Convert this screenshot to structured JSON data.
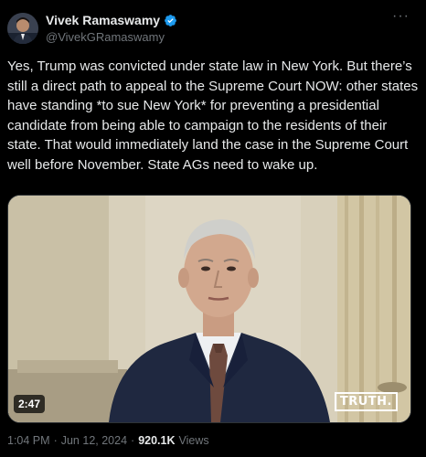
{
  "author": {
    "name": "Vivek Ramaswamy",
    "handle": "@VivekGRamaswamy",
    "verified": true,
    "verified_color": "#1d9bf0"
  },
  "more_menu": {
    "icon": "more-horizontal-icon",
    "glyph": "···"
  },
  "post": {
    "text": "Yes, Trump was convicted under state law in New York. But there’s still a direct path to appeal to the Supreme Court NOW: other states have standing *to sue New York* for preventing a presidential candidate from being able to campaign to the residents of their state. That would immediately land the case in the Supreme Court well before November. State AGs need to wake up."
  },
  "media": {
    "type": "video",
    "duration": "2:47",
    "watermark": "TRUTH."
  },
  "meta": {
    "time": "1:04 PM",
    "separator": "·",
    "date": "Jun 12, 2024",
    "views_count": "920.1K",
    "views_label": "Views"
  },
  "colors": {
    "background": "#000000",
    "text_primary": "#e7e9ea",
    "text_secondary": "#71767b",
    "border": "#2f3336"
  }
}
